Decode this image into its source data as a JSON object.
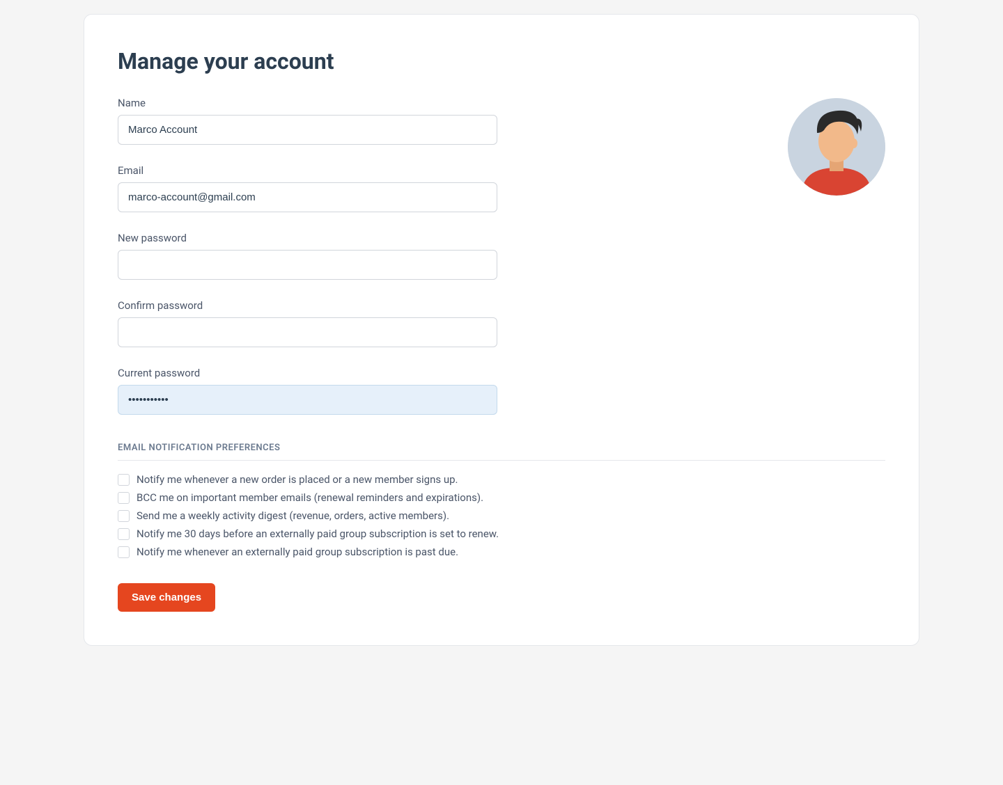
{
  "page": {
    "title": "Manage your account"
  },
  "fields": {
    "name": {
      "label": "Name",
      "value": "Marco Account"
    },
    "email": {
      "label": "Email",
      "value": "marco-account@gmail.com"
    },
    "new_password": {
      "label": "New password",
      "value": ""
    },
    "confirm_password": {
      "label": "Confirm password",
      "value": ""
    },
    "current_password": {
      "label": "Current password",
      "value": "•••••••••••"
    }
  },
  "preferences": {
    "section_title": "EMAIL NOTIFICATION PREFERENCES",
    "items": [
      {
        "label": "Notify me whenever a new order is placed or a new member signs up."
      },
      {
        "label": "BCC me on important member emails (renewal reminders and expirations)."
      },
      {
        "label": "Send me a weekly activity digest (revenue, orders, active members)."
      },
      {
        "label": "Notify me 30 days before an externally paid group subscription is set to renew."
      },
      {
        "label": "Notify me whenever an externally paid group subscription is past due."
      }
    ]
  },
  "actions": {
    "save_label": "Save changes"
  }
}
